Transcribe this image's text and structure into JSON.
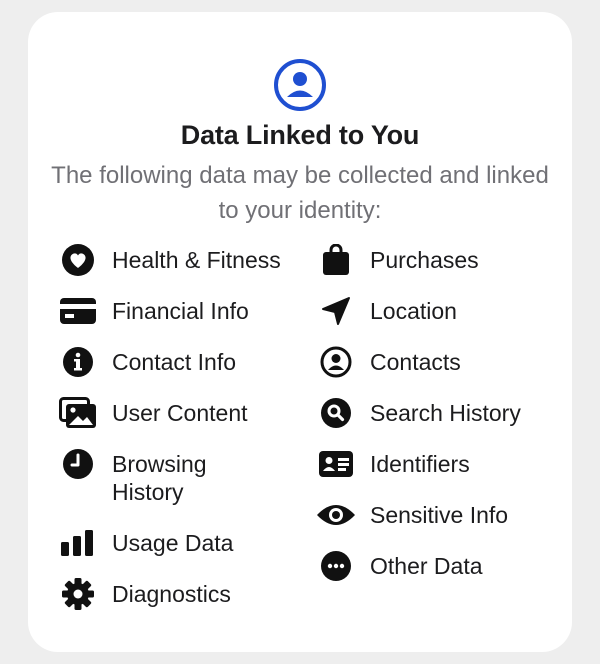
{
  "card": {
    "title": "Data Linked to You",
    "subtitle": "The following data may be collected and linked to your identity:",
    "header_icon": "person-circle-icon",
    "accent_color": "#1f4fd1"
  },
  "left_items": [
    {
      "label": "Health & Fitness",
      "icon": "heart-icon"
    },
    {
      "label": "Financial Info",
      "icon": "credit-card-icon"
    },
    {
      "label": "Contact Info",
      "icon": "info-icon"
    },
    {
      "label": "User Content",
      "icon": "photos-icon"
    },
    {
      "label": "Browsing History",
      "icon": "clock-icon"
    },
    {
      "label": "Usage Data",
      "icon": "bar-chart-icon"
    },
    {
      "label": "Diagnostics",
      "icon": "gear-icon"
    }
  ],
  "right_items": [
    {
      "label": "Purchases",
      "icon": "shopping-bag-icon"
    },
    {
      "label": "Location",
      "icon": "location-arrow-icon"
    },
    {
      "label": "Contacts",
      "icon": "person-circle-icon"
    },
    {
      "label": "Search History",
      "icon": "magnifying-glass-icon"
    },
    {
      "label": "Identifiers",
      "icon": "id-card-icon"
    },
    {
      "label": "Sensitive Info",
      "icon": "eye-icon"
    },
    {
      "label": "Other Data",
      "icon": "ellipsis-circle-icon"
    }
  ]
}
